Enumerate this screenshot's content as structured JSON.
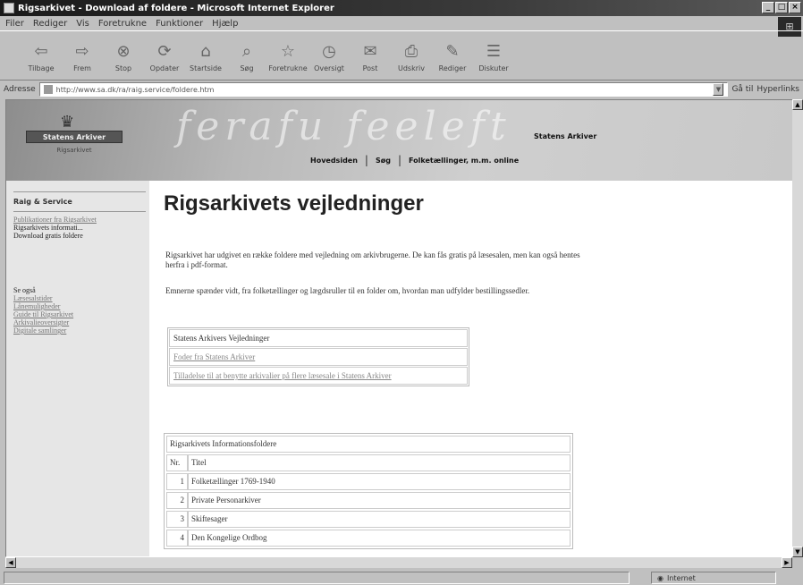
{
  "window": {
    "title": "Rigsarkivet - Download af foldere - Microsoft Internet Explorer"
  },
  "menu": [
    "Filer",
    "Rediger",
    "Vis",
    "Foretrukne",
    "Funktioner",
    "Hjælp"
  ],
  "toolbar": [
    {
      "label": "Tilbage",
      "icon": "back-icon",
      "glyph": "⇦"
    },
    {
      "label": "Frem",
      "icon": "forward-icon",
      "glyph": "⇨"
    },
    {
      "label": "Stop",
      "icon": "stop-icon",
      "glyph": "⊗"
    },
    {
      "label": "Opdater",
      "icon": "refresh-icon",
      "glyph": "⟳"
    },
    {
      "label": "Startside",
      "icon": "home-icon",
      "glyph": "⌂"
    },
    {
      "label": "Søg",
      "icon": "search-icon",
      "glyph": "⌕"
    },
    {
      "label": "Foretrukne",
      "icon": "favorites-icon",
      "glyph": "☆"
    },
    {
      "label": "Oversigt",
      "icon": "history-icon",
      "glyph": "◷"
    },
    {
      "label": "Post",
      "icon": "mail-icon",
      "glyph": "✉"
    },
    {
      "label": "Udskriv",
      "icon": "print-icon",
      "glyph": "⎙"
    },
    {
      "label": "Rediger",
      "icon": "edit-icon",
      "glyph": "✎"
    },
    {
      "label": "Diskuter",
      "icon": "discuss-icon",
      "glyph": "☰"
    }
  ],
  "address": {
    "label": "Adresse",
    "url": "http://www.sa.dk/ra/raig.service/foldere.htm",
    "go": "Gå til",
    "links": "Hyperlinks"
  },
  "header": {
    "script_text": "ferafu feeleft",
    "logo_text": "Statens Arkiver",
    "logo_sub": "Rigsarkivet",
    "org_name": "Statens Arkiver",
    "nav": [
      "Hovedsiden",
      "Søg",
      "Folketællinger, m.m. online"
    ]
  },
  "sidebar": {
    "section1_title": "Raig & Service",
    "section1_items": [
      {
        "text": "Publikationer fra Rigsarkivet",
        "link": true
      },
      {
        "text": "Rigsarkivets informati...",
        "link": false
      },
      {
        "text": "Download gratis foldere",
        "link": false
      }
    ],
    "section2_title": "Se også",
    "section2_items": [
      {
        "text": "Læsesalstider",
        "link": true
      },
      {
        "text": "Lånemuligheder",
        "link": true
      },
      {
        "text": "Guide til Rigsarkivet",
        "link": true
      },
      {
        "text": "Arkivalieoversigter",
        "link": true
      },
      {
        "text": "Digitale samlinger",
        "link": true
      }
    ]
  },
  "main": {
    "title": "Rigsarkivets vejledninger",
    "para1": "Rigsarkivet har udgivet en række foldere med vejledning om arkivbrugerne. De kan fås gratis på læsesalen, men kan også hentes herfra i pdf-format.",
    "para2": "Emnerne spænder vidt, fra folketællinger og lægdsruller til en folder om, hvordan man udfylder bestillingssedler.",
    "guide_box": {
      "header": "Statens Arkivers Vejledninger",
      "items": [
        "Foder fra Statens Arkiver",
        "Tilladelse til at benytte arkivalier på flere læsesale i Statens Arkiver"
      ]
    },
    "info_table": {
      "caption": "Rigsarkivets Informationsfoldere",
      "col_nr": "Nr.",
      "col_title": "Titel",
      "rows": [
        {
          "nr": "1",
          "title": "Folketællinger 1769-1940"
        },
        {
          "nr": "2",
          "title": "Private Personarkiver"
        },
        {
          "nr": "3",
          "title": "Skiftesager"
        },
        {
          "nr": "4",
          "title": "Den Kongelige Ordbog"
        }
      ]
    }
  },
  "status": {
    "zone": "Internet"
  }
}
